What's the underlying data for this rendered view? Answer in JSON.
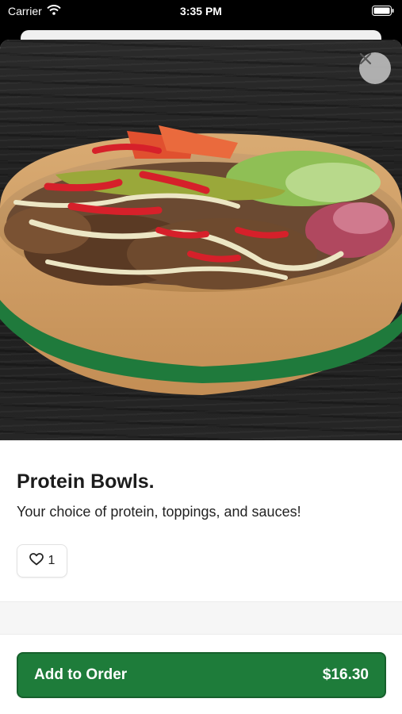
{
  "status_bar": {
    "carrier": "Carrier",
    "time": "3:35 PM"
  },
  "product": {
    "title": "Protein Bowls.",
    "description": "Your choice of protein, toppings, and sauces!",
    "likes": "1",
    "image_alt_icon": "protein-bowl-photo"
  },
  "actions": {
    "add_label": "Add to Order",
    "price": "$16.30"
  },
  "colors": {
    "accent": "#1e7c3a",
    "close_bg": "#bebebe",
    "background": "#ffffff"
  }
}
